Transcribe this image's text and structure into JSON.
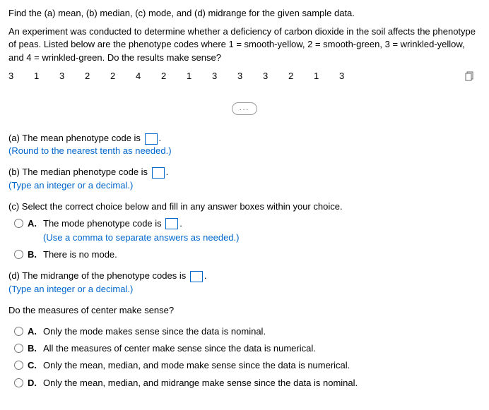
{
  "intro": "Find the (a) mean, (b) median, (c) mode, and (d) midrange for the given sample data.",
  "experiment": "An experiment was conducted to determine whether a deficiency of carbon dioxide in the soil affects the phenotype of peas. Listed below are the phenotype codes where 1 = smooth-yellow, 2 = smooth-green, 3 = wrinkled-yellow, and 4 = wrinkled-green. Do the results make sense?",
  "data_values": [
    "3",
    "1",
    "3",
    "2",
    "2",
    "4",
    "2",
    "1",
    "3",
    "3",
    "3",
    "2",
    "1",
    "3"
  ],
  "ellipsis": "...",
  "partA": {
    "text_before": "(a) The mean phenotype code is ",
    "text_after": ".",
    "hint": "(Round to the nearest tenth as needed.)"
  },
  "partB": {
    "text_before": "(b) The median phenotype code is ",
    "text_after": ".",
    "hint": "(Type an integer or a decimal.)"
  },
  "partC": {
    "prompt": "(c) Select the correct choice below and fill in any answer boxes within your choice.",
    "optA": {
      "letter": "A.",
      "text_before": "The mode phenotype code is ",
      "text_after": ".",
      "hint": "(Use a comma to separate answers as needed.)"
    },
    "optB": {
      "letter": "B.",
      "text": "There is no mode."
    }
  },
  "partD": {
    "text_before": "(d) The midrange of the phenotype codes is ",
    "text_after": ".",
    "hint": "(Type an integer or a decimal.)"
  },
  "finalQ": "Do the measures of center make sense?",
  "finalOptions": {
    "A": {
      "letter": "A.",
      "text": "Only the mode makes sense since the data is nominal."
    },
    "B": {
      "letter": "B.",
      "text": "All the measures of center make sense since the data is numerical."
    },
    "C": {
      "letter": "C.",
      "text": "Only the mean, median, and mode make sense since the data is numerical."
    },
    "D": {
      "letter": "D.",
      "text": "Only the mean, median, and midrange make sense since the data is nominal."
    }
  }
}
